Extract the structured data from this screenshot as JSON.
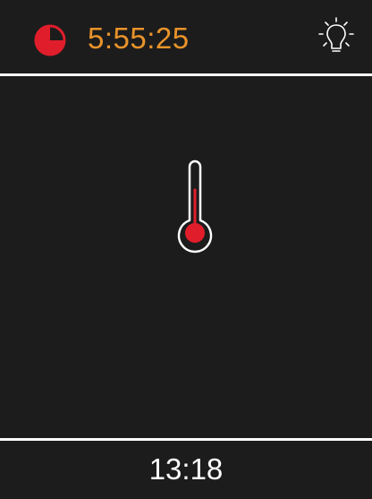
{
  "header": {
    "timer_icon": "timer-progress-icon",
    "timer_text": "5:55:25",
    "light_icon": "light-bulb-icon"
  },
  "main": {
    "thermometer_icon": "thermometer-icon"
  },
  "footer": {
    "time": "13:18"
  },
  "colors": {
    "background": "#1c1c1c",
    "timer_accent": "#e9932a",
    "thermo_red": "#e01e2b",
    "foreground": "#ffffff"
  }
}
